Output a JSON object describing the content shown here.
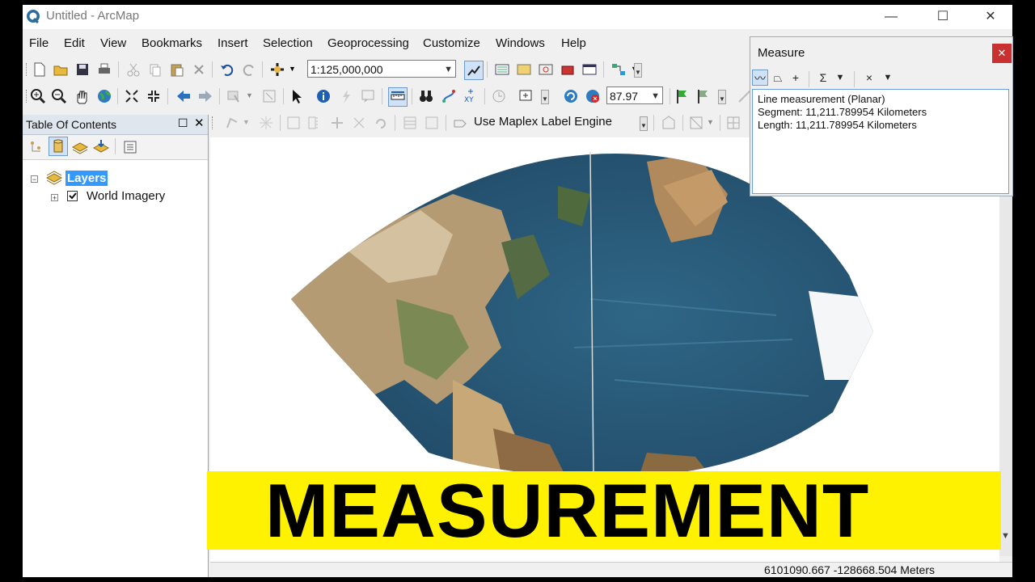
{
  "window": {
    "title": "Untitled - ArcMap",
    "controls": {
      "minimize": "—",
      "maximize": "☐",
      "close": "✕"
    }
  },
  "menu": [
    "File",
    "Edit",
    "View",
    "Bookmarks",
    "Insert",
    "Selection",
    "Geoprocessing",
    "Customize",
    "Windows",
    "Help"
  ],
  "toolbar": {
    "scale": "1:125,000,000",
    "zoom_percent": "87.97",
    "labeling": "Use Maplex Label Engine"
  },
  "toc": {
    "title": "Table Of Contents",
    "layers_label": "Layers",
    "layers": [
      {
        "name": "World Imagery",
        "checked": true
      }
    ]
  },
  "measure": {
    "title": "Measure",
    "lines": [
      "Line measurement (Planar)",
      "Segment: 11,211.789954 Kilometers",
      "Length: 11,211.789954 Kilometers"
    ]
  },
  "status": {
    "coordinates": "6101090.667  -128668.504 Meters"
  },
  "banner": {
    "text": "MEASUREMENT"
  },
  "colors": {
    "banner": "#fff200",
    "ocean": "#2c5a78",
    "land": "#b8a27c",
    "toc_header": "#dfe6ee",
    "selection": "#3399ff",
    "close_red": "#c8312f"
  }
}
